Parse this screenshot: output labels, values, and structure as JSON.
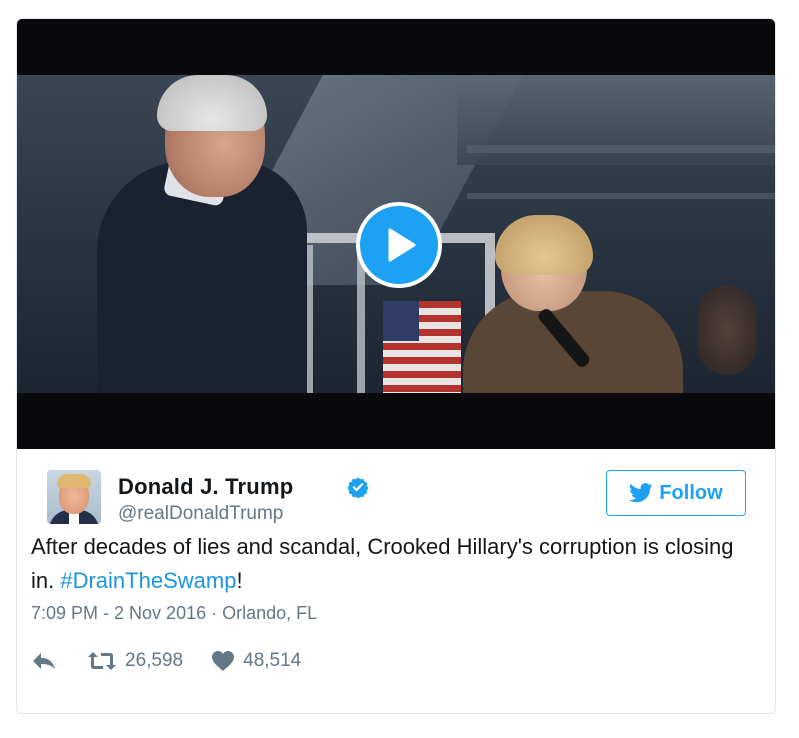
{
  "media": {
    "play_icon": "play-icon"
  },
  "author": {
    "display_name": "Donald J. Trump",
    "handle": "@realDonaldTrump",
    "verified_icon": "verified-badge-icon"
  },
  "follow": {
    "label": "Follow",
    "icon": "twitter-bird-icon",
    "color": "#1da1f2"
  },
  "tweet": {
    "text_before": "After decades of lies and scandal, Crooked Hillary's corruption is closing in. ",
    "hashtag": "#DrainTheSwamp",
    "text_after": "!",
    "hashtag_color": "#1b95e0"
  },
  "meta": {
    "time_location": "7:09 PM - 2 Nov 2016 · Orlando, FL"
  },
  "actions": {
    "reply_icon": "reply-icon",
    "retweet_icon": "retweet-icon",
    "retweet_count": "26,598",
    "like_icon": "heart-icon",
    "like_count": "48,514"
  }
}
